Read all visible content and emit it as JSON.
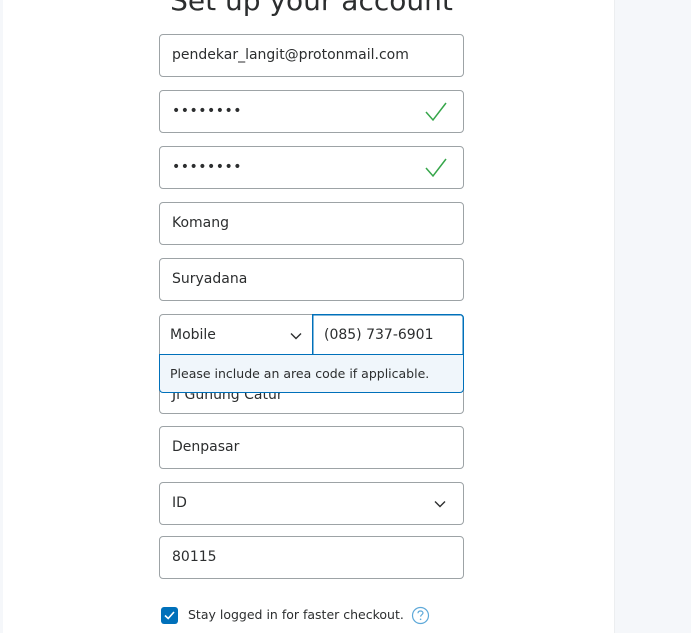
{
  "heading": "Set up your account",
  "form": {
    "email": "pendekar_langit@protonmail.com",
    "password": "••••••••",
    "confirm_password": "••••••••",
    "first_name": "Komang",
    "last_name": "Suryadana",
    "phone_type": "Mobile",
    "phone_number": "(085) 737-6901",
    "phone_hint": "Please include an area code if applicable.",
    "street": "Jl Gunung Catur",
    "city": "Denpasar",
    "state": "ID",
    "postal_code": "80115",
    "stay_logged_in_label": "Stay logged in for faster checkout.",
    "stay_logged_in_checked": true
  },
  "colors": {
    "accent": "#0070ba",
    "valid": "#36a64a",
    "border": "#9da3a6"
  }
}
